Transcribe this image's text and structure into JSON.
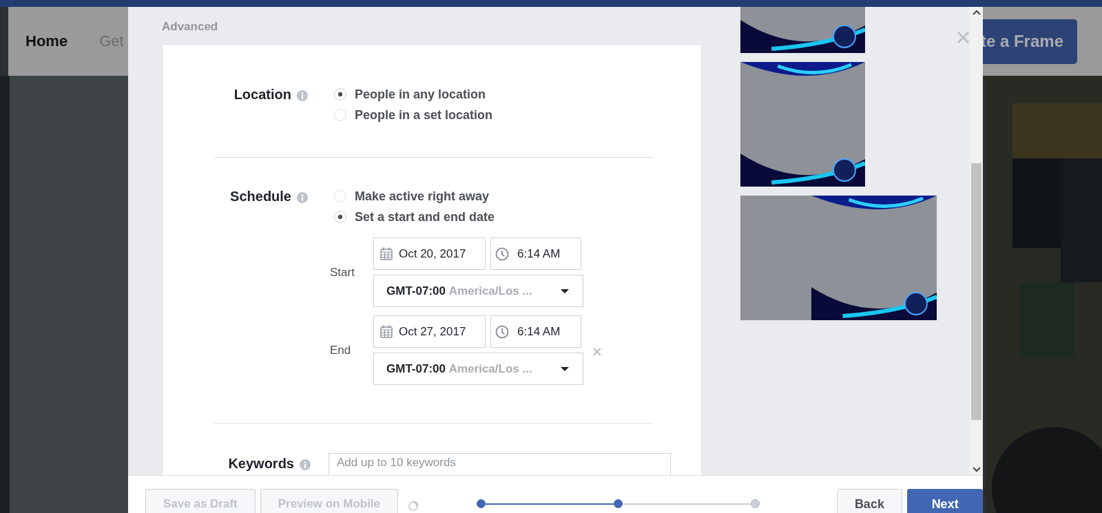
{
  "background_page": {
    "nav": [
      {
        "label": "Home",
        "selected": true
      },
      {
        "label": "Get",
        "selected": false
      }
    ],
    "create_button": "te a Frame"
  },
  "modal": {
    "section_title": "Advanced",
    "location": {
      "label": "Location",
      "options": [
        {
          "label": "People in any location",
          "selected": true
        },
        {
          "label": "People in a set location",
          "selected": false
        }
      ]
    },
    "schedule": {
      "label": "Schedule",
      "options": [
        {
          "label": "Make active right away",
          "selected": false
        },
        {
          "label": "Set a start and end date",
          "selected": true
        }
      ],
      "ranges": [
        {
          "label": "Start",
          "date": "Oct 20, 2017",
          "time": "6:14 AM",
          "timezone_offset": "GMT-07:00",
          "timezone_name": "America/Los ...",
          "removable": false
        },
        {
          "label": "End",
          "date": "Oct 27, 2017",
          "time": "6:14 AM",
          "timezone_offset": "GMT-07:00",
          "timezone_name": "America/Los ...",
          "removable": true
        }
      ]
    },
    "keywords": {
      "label": "Keywords",
      "placeholder": "Add up to 10 keywords"
    },
    "footer": {
      "buttons": [
        {
          "label": "Save as Draft",
          "disabled": true
        },
        {
          "label": "Preview on Mobile",
          "disabled": true
        }
      ],
      "loading": true,
      "steps": [
        {
          "reached": true
        },
        {
          "reached": true
        },
        {
          "reached": false
        }
      ],
      "nav_buttons": [
        {
          "label": "Back",
          "kind": "secondary"
        },
        {
          "label": "Next",
          "kind": "primary"
        }
      ]
    }
  }
}
